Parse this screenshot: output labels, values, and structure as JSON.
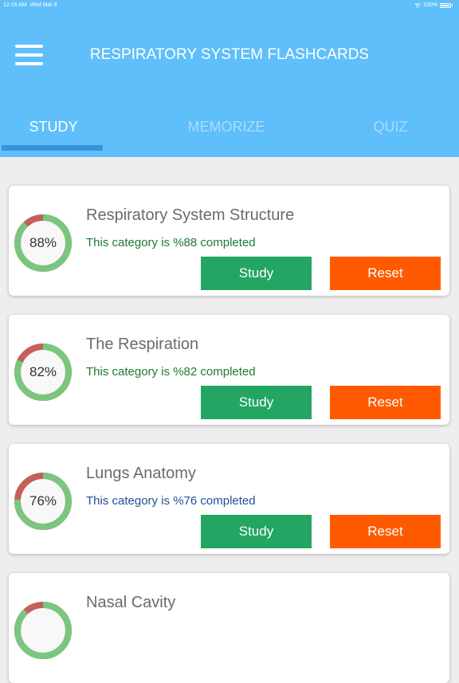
{
  "status_bar": {
    "time": "12:16 AM",
    "date": "Wed Mar 8",
    "battery": "100%"
  },
  "header": {
    "title": "RESPIRATORY SYSTEM FLASHCARDS",
    "menu_icon": "hamburger-menu-icon"
  },
  "tabs": [
    {
      "label": "STUDY",
      "active": true
    },
    {
      "label": "MEMORIZE",
      "active": false
    },
    {
      "label": "QUIZ",
      "active": false
    }
  ],
  "colors": {
    "header_bg": "#5fbffa",
    "ring_progress": "#7bc67e",
    "ring_remaining": "#c4605a",
    "study_button": "#23a563",
    "reset_button": "#ff5a00",
    "status_green": "#1f7a2e",
    "status_blue": "#1f4f9a"
  },
  "categories": [
    {
      "title": "Respiratory System Structure",
      "percent": 88,
      "percent_label": "88%",
      "status": "This category is %88 completed",
      "status_color": "#1f7a2e",
      "study_label": "Study",
      "reset_label": "Reset"
    },
    {
      "title": "The Respiration",
      "percent": 82,
      "percent_label": "82%",
      "status": "This category is %82 completed",
      "status_color": "#1f7a2e",
      "study_label": "Study",
      "reset_label": "Reset"
    },
    {
      "title": "Lungs Anatomy",
      "percent": 76,
      "percent_label": "76%",
      "status": "This category is %76 completed",
      "status_color": "#1f4f9a",
      "study_label": "Study",
      "reset_label": "Reset"
    },
    {
      "title": "Nasal Cavity",
      "percent": 88,
      "percent_label": "",
      "status": "",
      "status_color": "#1f7a2e",
      "study_label": "",
      "reset_label": ""
    }
  ]
}
